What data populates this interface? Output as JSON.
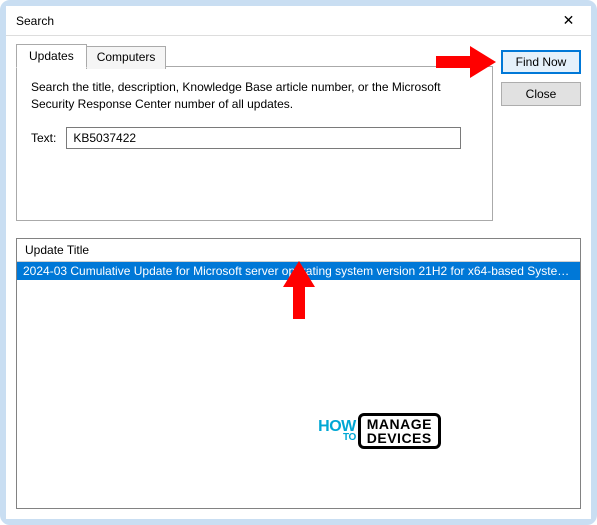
{
  "window": {
    "title": "Search",
    "close_glyph": "✕"
  },
  "tabs": {
    "updates": "Updates",
    "computers": "Computers"
  },
  "panel": {
    "instruction": "Search the title, description, Knowledge Base article number, or the Microsoft Security Response Center number of all updates.",
    "text_label": "Text:",
    "text_value": "KB5037422"
  },
  "buttons": {
    "find_now": "Find Now",
    "close": "Close"
  },
  "results": {
    "header": "Update Title",
    "rows": [
      "2024-03 Cumulative Update for Microsoft server operating system version 21H2 for x64-based System..."
    ]
  },
  "watermark": {
    "how": "HOW",
    "to": "TO",
    "line1": "MANAGE",
    "line2": "DEVICES"
  }
}
